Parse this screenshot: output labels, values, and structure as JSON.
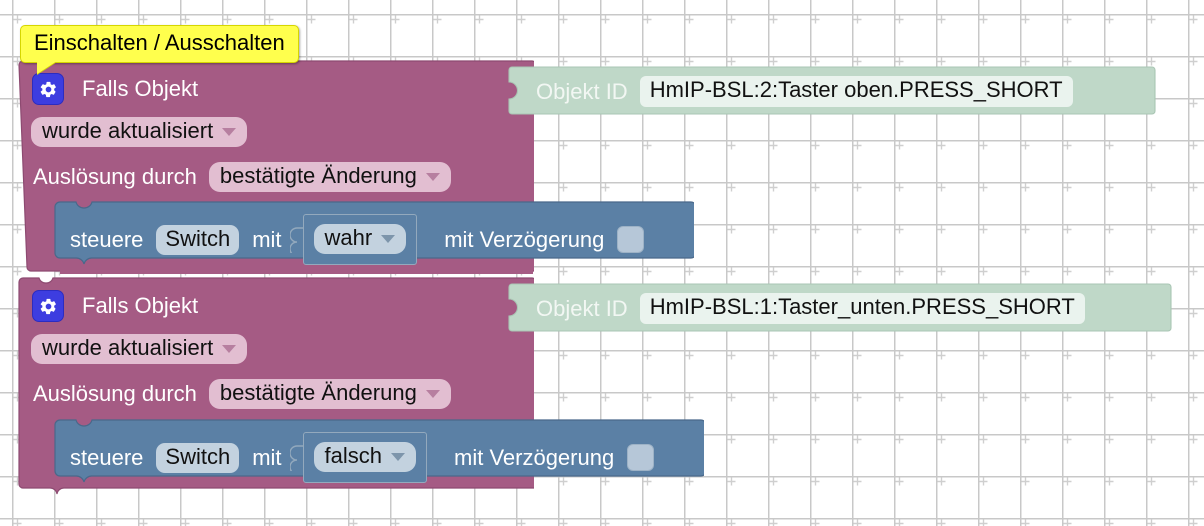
{
  "workspace": {
    "comment_label": "Einschalten / Ausschalten",
    "grid_color": "#c8c8c8",
    "background_color": "#ffffff"
  },
  "colors": {
    "trigger_block": "#A55B84",
    "action_block": "#5B80A5",
    "value_block": "#BFD8C8",
    "comment": "#FFFF4D",
    "mutator_icon": "#3D3DE0"
  },
  "blocks": [
    {
      "id": "trigger-1",
      "type": "on-object-change",
      "mutator_icon": "gear-icon",
      "title": "Falls Objekt",
      "object_id_label": "Objekt ID",
      "object_id_value": "HmIP-BSL:2:Taster oben.PRESS_SHORT",
      "condition_dropdown": "wurde aktualisiert",
      "trigger_label": "Auslösung durch",
      "trigger_dropdown": "bestätigte Änderung",
      "statement": {
        "id": "control-1",
        "type": "control-object",
        "verb": "steuere",
        "target": "Switch",
        "with_label": "mit",
        "value_dropdown": "wahr",
        "delay_label": "mit Verzögerung",
        "delay_checked": false
      }
    },
    {
      "id": "trigger-2",
      "type": "on-object-change",
      "mutator_icon": "gear-icon",
      "title": "Falls Objekt",
      "object_id_label": "Objekt ID",
      "object_id_value": "HmIP-BSL:1:Taster_unten.PRESS_SHORT",
      "condition_dropdown": "wurde aktualisiert",
      "trigger_label": "Auslösung durch",
      "trigger_dropdown": "bestätigte Änderung",
      "statement": {
        "id": "control-2",
        "type": "control-object",
        "verb": "steuere",
        "target": "Switch",
        "with_label": "mit",
        "value_dropdown": "falsch",
        "delay_label": "mit Verzögerung",
        "delay_checked": false
      }
    }
  ]
}
